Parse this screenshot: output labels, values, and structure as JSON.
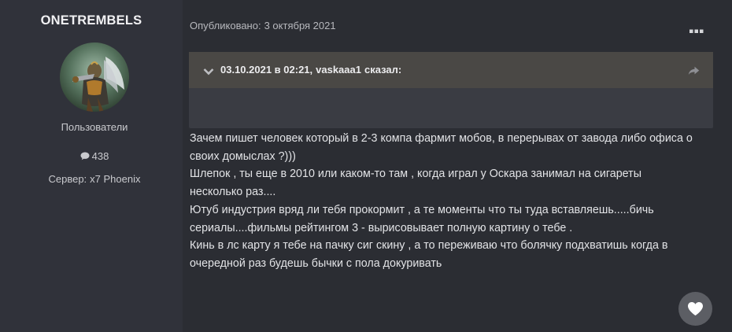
{
  "author": {
    "name": "ONETREMBELS",
    "group": "Пользователи",
    "posts_count": "438",
    "server_label": "Сервер:",
    "server_value": "x7 Phoenix"
  },
  "post": {
    "published_label": "Опубликовано:",
    "published_date": "3 октября 2021",
    "quote": {
      "date": "03.10.2021 в 02:21,",
      "author": "vaskaaa1",
      "said": "сказал:"
    },
    "lines": [
      "Зачем пишет человек который в 2-3 компа фармит мобов, в перерывах от завода либо офиса о",
      "своих домыслах ?)))",
      "Шлепок , ты еще в 2010 или каком-то там , когда играл у Оскара занимал на сигареты",
      "несколько раз....",
      "Ютуб индустрия вряд ли тебя прокормит , а те моменты что ты туда вставляешь.....бичь",
      "сериалы....фильмы рейтингом 3 - вырисовывает полную картину о тебе .",
      "Кинь в лс карту я тебе на пачку сиг скину , а то переживаю что болячку подхватишь когда в",
      "очередной раз будешь бычки с пола докуривать"
    ]
  },
  "icons": {
    "posts": "comment-icon",
    "menu": "more-horizontal-icon",
    "quote_toggle": "chevron-down-icon",
    "quote_link": "share-arrow-icon",
    "reaction": "heart-icon"
  },
  "colors": {
    "page_bg": "#2b2d33",
    "sidebar_bg": "#30323a",
    "quote_header_bg": "#4a4845",
    "quote_body_bg": "#3a3c43",
    "like_button_bg": "#5c5e64"
  }
}
